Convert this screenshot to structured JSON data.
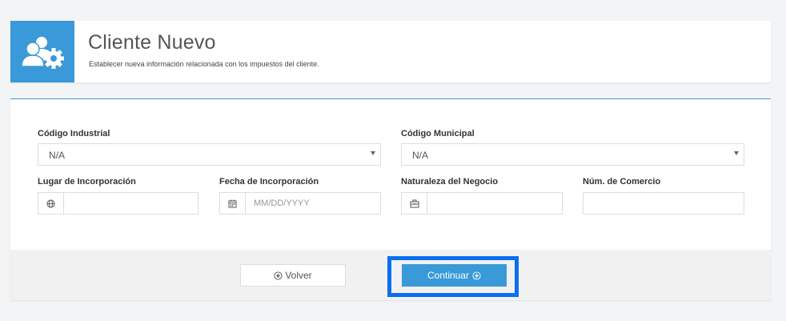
{
  "header": {
    "icon": "users-gear-icon",
    "title": "Cliente Nuevo",
    "subtitle": "Establecer nueva información relacionada con los impuestos del cliente."
  },
  "form": {
    "codigo_industrial": {
      "label": "Código Industrial",
      "value": "N/A"
    },
    "codigo_municipal": {
      "label": "Código Municipal",
      "value": "N/A"
    },
    "lugar_incorporacion": {
      "label": "Lugar de Incorporación",
      "value": "",
      "icon": "globe-icon"
    },
    "fecha_incorporacion": {
      "label": "Fecha de Incorporación",
      "placeholder": "MM/DD/YYYY",
      "icon": "calendar-icon"
    },
    "naturaleza_negocio": {
      "label": "Naturaleza del Negocio",
      "value": "",
      "icon": "briefcase-icon"
    },
    "num_comercio": {
      "label": "Núm. de Comercio",
      "value": ""
    }
  },
  "footer": {
    "volver_label": "Volver",
    "continuar_label": "Continuar"
  },
  "colors": {
    "accent": "#3a99d8",
    "highlight": "#0a6ff0",
    "page_bg": "#f3f4f6",
    "footer_bg": "#f1f1f1"
  }
}
